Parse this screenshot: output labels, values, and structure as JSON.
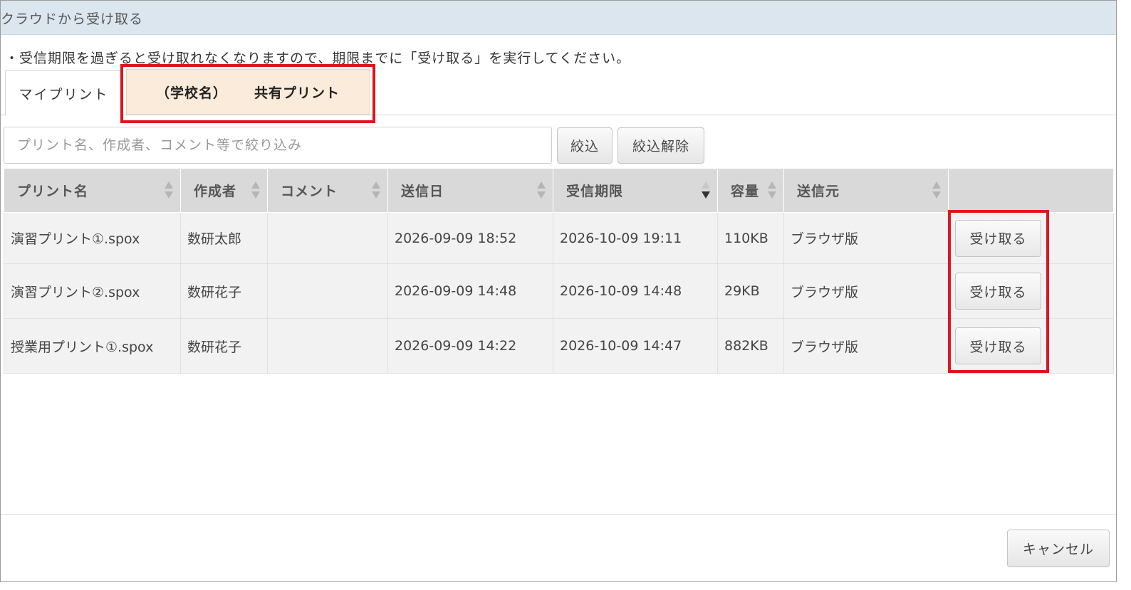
{
  "window": {
    "title": "クラウドから受け取る"
  },
  "notice": "・受信期限を過ぎると受け取れなくなりますので、期限までに「受け取る」を実行してください。",
  "tabs": [
    {
      "label": "マイプリント",
      "active": false
    },
    {
      "school": "（学校名）",
      "label": "共有プリント",
      "active": true
    }
  ],
  "search": {
    "placeholder": "プリント名、作成者、コメント等で絞り込み",
    "value": ""
  },
  "toolbar": {
    "filter_label": "絞込",
    "clear_label": "絞込解除"
  },
  "table": {
    "columns": [
      "プリント名",
      "作成者",
      "コメント",
      "送信日",
      "受信期限",
      "容量",
      "送信元",
      ""
    ],
    "sorted_column": "受信期限",
    "sort_direction": "descending",
    "rows": [
      {
        "name": "演習プリント①.spox",
        "author": "数研太郎",
        "comment": "",
        "sent": "2026-09-09 18:52",
        "deadline": "2026-10-09 19:11",
        "size": "110KB",
        "source": "ブラウザ版",
        "action": "受け取る"
      },
      {
        "name": "演習プリント②.spox",
        "author": "数研花子",
        "comment": "",
        "sent": "2026-09-09 14:48",
        "deadline": "2026-10-09 14:48",
        "size": "29KB",
        "source": "ブラウザ版",
        "action": "受け取る"
      },
      {
        "name": "授業用プリント①.spox",
        "author": "数研花子",
        "comment": "",
        "sent": "2026-09-09 14:22",
        "deadline": "2026-10-09 14:47",
        "size": "882KB",
        "source": "ブラウザ版",
        "action": "受け取る"
      }
    ]
  },
  "footer": {
    "cancel_label": "キャンセル"
  },
  "colors": {
    "highlight": "#e0141e",
    "titlebar": "#dbe6ee",
    "active_tab": "#fbebda",
    "header": "#d9d9d9"
  }
}
